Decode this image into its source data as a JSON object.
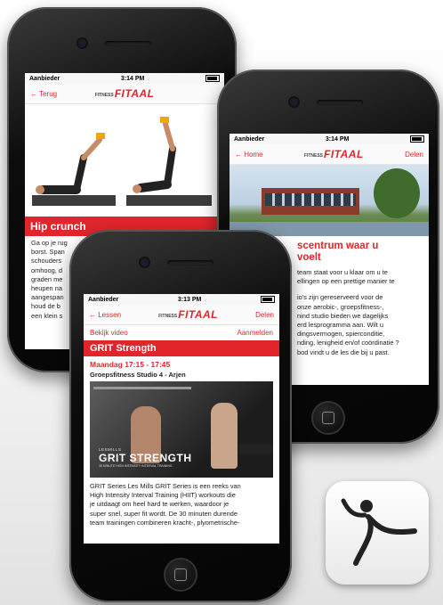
{
  "phone_left": {
    "status": {
      "carrier": "Aanbieder",
      "time": "3:14 PM"
    },
    "nav": {
      "back": "Terug",
      "logo_small": "FITNESS",
      "logo_big": "FITAAL"
    },
    "title": "Hip crunch",
    "text_lines": [
      "Ga op je rug",
      "borst. Span",
      "schouders",
      "omhoog, d",
      "graden me",
      "heupen na",
      "aangespan",
      "houd de b",
      "een klein s"
    ]
  },
  "phone_right": {
    "status": {
      "carrier": "Aanbieder",
      "time": "3:14 PM"
    },
    "nav": {
      "back": "Home",
      "logo_small": "FITNESS",
      "logo_big": "FITAAL",
      "action": "Delen"
    },
    "title_lines": [
      "scentrum waar u",
      "voelt"
    ],
    "text_lines": [
      "team staat voor u klaar om u te",
      "ellingen op een prettige manier te",
      "",
      "io's zijn gereserveerd voor de",
      "onze aerobic-, groepsfitness-,",
      "nind studio bieden we dagelijks",
      "erd lesprogramma aan. Wilt u",
      "dingsvermogen, spierconditie,",
      "nding, lenigheid en/of coördinatie ?",
      "bod vindt u de les die bij u past."
    ]
  },
  "phone_front": {
    "status": {
      "carrier": "Aanbieder",
      "time": "3:13 PM"
    },
    "nav": {
      "back": "Lessen",
      "logo_small": "FITNESS",
      "logo_big": "FITAAL",
      "action": "Delen"
    },
    "links": {
      "video": "Bekijk video",
      "signup": "Aanmelden"
    },
    "title": "GRIT Strength",
    "schedule": "Maandag 17:15 - 17:45",
    "location": "Groepsfitness Studio 4 - Arjen",
    "banner": {
      "brand": "LESMILLS",
      "name": "GRIT STRENGTH",
      "tagline": "30 MINUTE HIGH INTENSITY INTERVAL TRAINING"
    },
    "text_lines": [
      "GRIT Series Les Mills GRIT Series is een reeks van",
      "High Intensity Interval Training (HIIT) workouts die",
      "je uitdaagt om heel hard te werken, waardoor je",
      "super snel, super fit wordt. De 30 minuten durende",
      "team trainingen combineren kracht-, plyometrische-"
    ]
  },
  "app_icon": {
    "name": "fitaal-app-icon"
  },
  "colors": {
    "accent": "#e0262b"
  }
}
